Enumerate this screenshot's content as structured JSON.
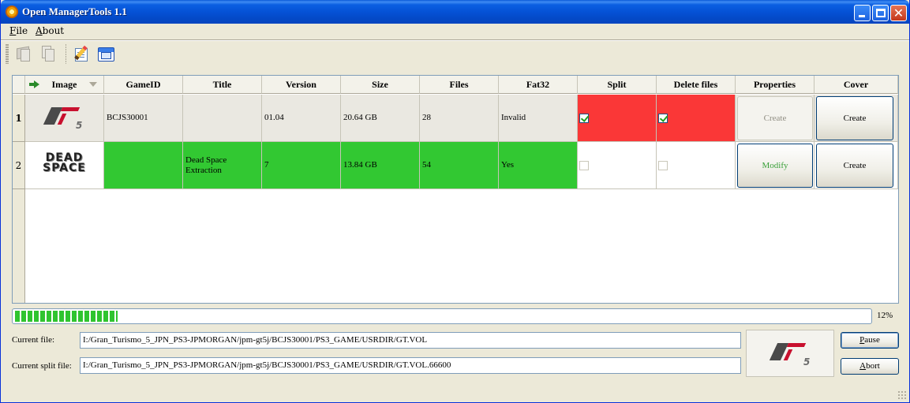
{
  "window": {
    "title": "Open ManagerTools 1.1"
  },
  "menu": [
    {
      "mnemonic": "F",
      "rest": "ile"
    },
    {
      "mnemonic": "A",
      "rest": "bout"
    }
  ],
  "toolbar": {
    "icons": [
      "copy-disabled-icon",
      "duplicate-disabled-icon",
      "edit-icon",
      "window-icon"
    ]
  },
  "grid": {
    "columns": [
      "Image",
      "GameID",
      "Title",
      "Version",
      "Size",
      "Files",
      "Fat32",
      "Split",
      "Delete files",
      "Properties",
      "Cover"
    ],
    "rows": [
      {
        "index": "1",
        "image": "gran-turismo-5-logo",
        "game_id": "BCJS30001",
        "title": "",
        "version": "01.04",
        "size": "20.64 GB",
        "files": "28",
        "fat32": "Invalid",
        "split": true,
        "delete_files": true,
        "properties": "Create",
        "cover": "Create"
      },
      {
        "index": "2",
        "image": "dead-space-extraction-logo",
        "image_text": [
          "DEAD",
          "SPACE"
        ],
        "game_id": "",
        "title": "Dead Space Extraction",
        "version": "7",
        "size": "13.84 GB",
        "files": "54",
        "fat32": "Yes",
        "split": false,
        "delete_files": false,
        "properties": "Modify",
        "cover": "Create"
      }
    ],
    "colors": {
      "red": "#fa3737",
      "green": "#32c832"
    }
  },
  "progress": {
    "value": 0.12,
    "label": "12%"
  },
  "current_file": {
    "label": "Current file:",
    "value": "I:/Gran_Turismo_5_JPN_PS3-JPMORGAN/jpm-gt5j/BCJS30001/PS3_GAME/USRDIR/GT.VOL"
  },
  "current_split_file": {
    "label": "Current split file:",
    "value": "I:/Gran_Turismo_5_JPN_PS3-JPMORGAN/jpm-gt5j/BCJS30001/PS3_GAME/USRDIR/GT.VOL.66600"
  },
  "buttons": {
    "pause": {
      "mnemonic": "P",
      "rest": "ause"
    },
    "abort": {
      "mnemonic": "A",
      "rest": "bort"
    }
  }
}
